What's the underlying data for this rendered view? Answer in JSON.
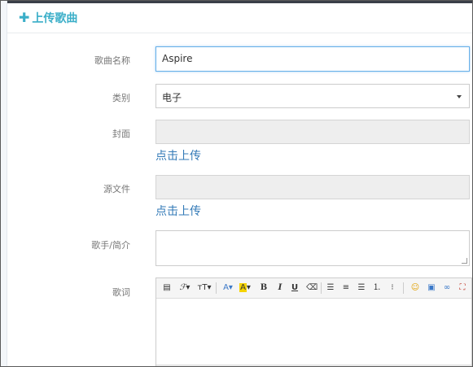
{
  "panel": {
    "title": "上传歌曲",
    "plus_icon": "plus-icon"
  },
  "form": {
    "name_label": "歌曲名称",
    "name_value": "Aspire",
    "category_label": "类别",
    "category_value": "电子",
    "cover_label": "封面",
    "cover_upload": "点击上传",
    "source_label": "源文件",
    "source_upload": "点击上传",
    "singer_label": "歌手/简介",
    "lyrics_label": "歌词"
  },
  "toolbar_icons": [
    "source-icon",
    "font-family-icon",
    "font-size-icon",
    "font-color-icon",
    "highlight-icon",
    "bold-icon",
    "italic-icon",
    "underline-icon",
    "eraser-icon",
    "align-left-icon",
    "align-center-icon",
    "align-right-icon",
    "ordered-list-icon",
    "unordered-list-icon",
    "emoji-icon",
    "image-icon",
    "link-icon",
    "fullscreen-icon"
  ],
  "colors": {
    "accent": "#3aaec8",
    "link": "#337ab7",
    "focus_border": "#66afe9"
  }
}
